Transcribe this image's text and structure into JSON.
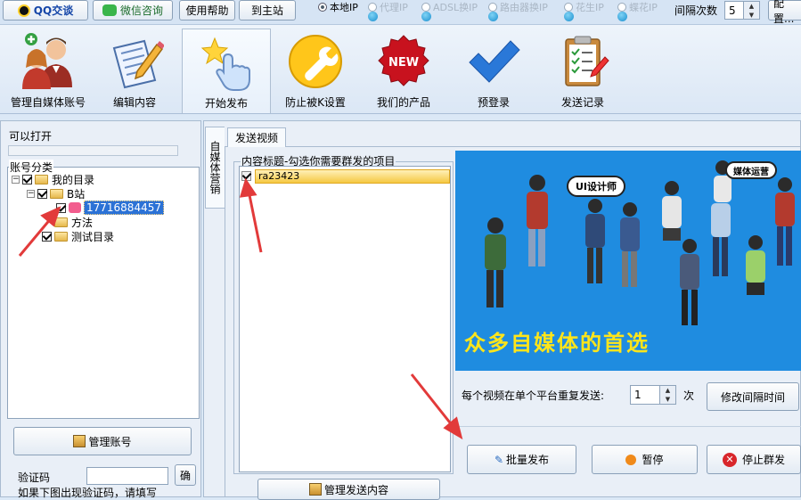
{
  "top": {
    "qq_label": "QQ交谈",
    "wechat_label": "微信咨询",
    "help_label": "使用帮助",
    "site_label": "到主站",
    "ip_options": [
      {
        "label": "本地IP",
        "selected": true,
        "enabled": true
      },
      {
        "label": "代理IP",
        "selected": false,
        "enabled": false
      },
      {
        "label": "ADSL换IP",
        "selected": false,
        "enabled": false
      },
      {
        "label": "路由器换IP",
        "selected": false,
        "enabled": false
      },
      {
        "label": "花生IP",
        "selected": false,
        "enabled": false
      },
      {
        "label": "蝶花IP",
        "selected": false,
        "enabled": false
      }
    ],
    "interval_label": "间隔次数",
    "interval_value": "5",
    "config_label": "配置..."
  },
  "toolbar": [
    {
      "label": "管理自媒体账号",
      "icon": "users-icon",
      "active": false
    },
    {
      "label": "编辑内容",
      "icon": "edit-document-icon",
      "active": false
    },
    {
      "label": "开始发布",
      "icon": "hand-pointer-icon",
      "active": true
    },
    {
      "label": "防止被K设置",
      "icon": "wrench-icon",
      "active": false
    },
    {
      "label": "我们的产品",
      "icon": "new-badge-icon",
      "active": false
    },
    {
      "label": "预登录",
      "icon": "checkmark-icon",
      "active": false
    },
    {
      "label": "发送记录",
      "icon": "clipboard-icon",
      "active": false
    }
  ],
  "left": {
    "status_label": "可以打开",
    "tree_title": "账号分类",
    "tree": {
      "root": "我的目录",
      "group1": "B站",
      "account": "17716884457",
      "group2": "方法",
      "group3": "测试目录"
    },
    "manage_btn": "管理账号",
    "captcha_label": "验证码",
    "captcha_btn": "确",
    "captcha_hint": "如果下图出现验证码，请填写"
  },
  "main": {
    "side_tab": "自媒体营销",
    "tab_label": "发送视频",
    "list_title": "内容标题-勾选你需要群发的项目",
    "items": [
      {
        "label": "ra23423",
        "checked": true
      }
    ],
    "manage_content_btn": "管理发送内容",
    "banner": {
      "slogan": "众多自媒体的首选",
      "bubble1": "UI设计师",
      "bubble2": "媒体运营"
    },
    "repeat_label": "每个视频在单个平台重复发送:",
    "repeat_value": "1",
    "repeat_unit": "次",
    "modify_btn": "修改间隔时间",
    "batch_btn": "批量发布",
    "pause_btn": "暂停",
    "stop_btn": "停止群发"
  },
  "colors": {
    "banner_bg": "#1f8ce0",
    "slogan": "#ffe51a",
    "arrow": "#e23a3a",
    "selected_row": "#f5c842"
  }
}
